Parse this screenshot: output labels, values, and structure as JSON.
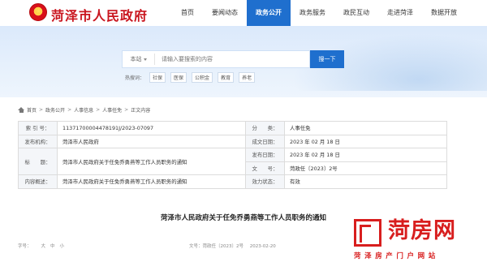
{
  "header": {
    "site_title": "菏泽市人民政府",
    "nav": [
      "首页",
      "要闻动态",
      "政务公开",
      "政务服务",
      "政民互动",
      "走进菏泽",
      "数据开放"
    ],
    "active_nav": "政务公开"
  },
  "search": {
    "scope": "本站",
    "placeholder": "请输入要搜索的内容",
    "button": "搜一下",
    "hot_label": "热搜词：",
    "hot_tags": [
      "社保",
      "医保",
      "公积金",
      "教育",
      "养老"
    ]
  },
  "breadcrumb": [
    "首页",
    "政务公开",
    "人事信息",
    "人事任免",
    "正文内容"
  ],
  "meta": {
    "index_label": "索 引 号：",
    "index_value": "11371700004478191J/2023-07097",
    "category_label": "分　　类：",
    "category_value": "人事任免",
    "org_label": "发布机构：",
    "org_value": "菏泽市人民政府",
    "created_label": "成文日期：",
    "created_value": "2023 年 02 月 18 日",
    "title_label": "标　　题：",
    "title_value": "菏泽市人民政府关于任免乔勇燕等工作人员职务的通知",
    "published_label": "发布日期：",
    "published_value": "2023 年 02 月 18 日",
    "docno_label": "文　　号：",
    "docno_value": "菏政任〔2023〕2号",
    "summary_label": "内容概述：",
    "summary_value": "菏泽市人民政府关于任免乔勇燕等工作人员职务的通知",
    "status_label": "效力状态：",
    "status_value": "有效"
  },
  "article": {
    "title": "菏泽市人民政府关于任免乔勇燕等工作人员职务的通知",
    "font_label": "字号：",
    "sizes": [
      "大",
      "中",
      "小"
    ],
    "doc_ref": "文号：菏政任〔2023〕2号",
    "date": "2023-02-20"
  },
  "watermark": {
    "big": "菏房网",
    "small": "菏泽房产门户网站"
  }
}
